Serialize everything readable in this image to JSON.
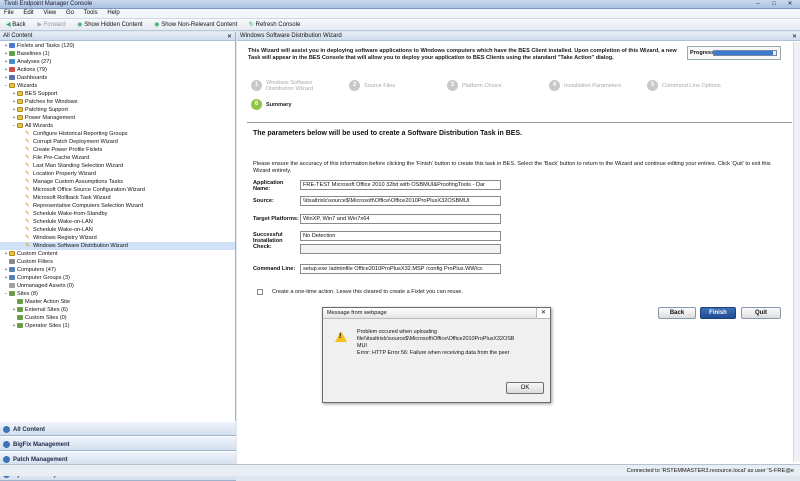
{
  "window": {
    "title": "Tivoli Endpoint Manager Console",
    "min": "–",
    "max": "□",
    "close": "✕"
  },
  "menu": [
    "File",
    "Edit",
    "View",
    "Go",
    "Tools",
    "Help"
  ],
  "toolbar": {
    "back": "Back",
    "forward": "Forward",
    "show_hidden": "Show Hidden Content",
    "show_nonrelevant": "Show Non-Relevant Content",
    "refresh": "Refresh Console"
  },
  "left_header": {
    "title": "All Content",
    "close": "✕"
  },
  "tree": [
    {
      "label": "Fixlets and Tasks (120)",
      "level": 0,
      "icon": "fixlet-icon",
      "exp": "+"
    },
    {
      "label": "Baselines (1)",
      "level": 0,
      "icon": "baseline-icon",
      "exp": "+"
    },
    {
      "label": "Analyses (27)",
      "level": 0,
      "icon": "analysis-icon",
      "exp": "+"
    },
    {
      "label": "Actions (79)",
      "level": 0,
      "icon": "action-icon",
      "exp": "+"
    },
    {
      "label": "Dashboards",
      "level": 0,
      "icon": "dashboard-icon",
      "exp": "+"
    },
    {
      "label": "Wizards",
      "level": 0,
      "icon": "folder-icon",
      "exp": "−"
    },
    {
      "label": "BES Support",
      "level": 1,
      "icon": "folder-icon",
      "exp": "+"
    },
    {
      "label": "Patches for Windows",
      "level": 1,
      "icon": "folder-icon",
      "exp": "+"
    },
    {
      "label": "Patching Support",
      "level": 1,
      "icon": "folder-icon",
      "exp": "+"
    },
    {
      "label": "Power Management",
      "level": 1,
      "icon": "folder-icon",
      "exp": "+"
    },
    {
      "label": "All Wizards",
      "level": 1,
      "icon": "folder-icon",
      "exp": "−"
    },
    {
      "label": "Configure Historical Reporting Groups",
      "level": 2,
      "icon": "wizard-icon",
      "exp": ""
    },
    {
      "label": "Corrupt Patch Deployment Wizard",
      "level": 2,
      "icon": "wizard-icon",
      "exp": ""
    },
    {
      "label": "Create Power Profile Fixlets",
      "level": 2,
      "icon": "wizard-icon",
      "exp": ""
    },
    {
      "label": "File Pre-Cache Wizard",
      "level": 2,
      "icon": "wizard-icon",
      "exp": ""
    },
    {
      "label": "Last Man Standing Selection Wizard",
      "level": 2,
      "icon": "wizard-icon",
      "exp": ""
    },
    {
      "label": "Location Property Wizard",
      "level": 2,
      "icon": "wizard-icon",
      "exp": ""
    },
    {
      "label": "Manage Custom Assumptions Tasks",
      "level": 2,
      "icon": "wizard-icon",
      "exp": ""
    },
    {
      "label": "Microsoft Office Source Configuration Wizard",
      "level": 2,
      "icon": "wizard-icon",
      "exp": ""
    },
    {
      "label": "Microsoft Rollback Task Wizard",
      "level": 2,
      "icon": "wizard-icon",
      "exp": ""
    },
    {
      "label": "Representative Computers Selection Wizard",
      "level": 2,
      "icon": "wizard-icon",
      "exp": ""
    },
    {
      "label": "Schedule Wake-from-Standby",
      "level": 2,
      "icon": "wizard-icon",
      "exp": ""
    },
    {
      "label": "Schedule Wake-on-LAN",
      "level": 2,
      "icon": "wizard-icon",
      "exp": ""
    },
    {
      "label": "Schedule Wake-on-LAN",
      "level": 2,
      "icon": "wizard-icon",
      "exp": ""
    },
    {
      "label": "Windows Registry Wizard",
      "level": 2,
      "icon": "wizard-icon",
      "exp": ""
    },
    {
      "label": "Windows Software Distribution Wizard",
      "level": 2,
      "icon": "wizard-icon",
      "exp": "",
      "selected": true
    },
    {
      "label": "Custom Content",
      "level": 0,
      "icon": "folder-icon",
      "exp": "+"
    },
    {
      "label": "Custom Filters",
      "level": 0,
      "icon": "filter-icon",
      "exp": ""
    },
    {
      "label": "Computers (47)",
      "level": 0,
      "icon": "computer-icon",
      "exp": "+"
    },
    {
      "label": "Computer Groups (3)",
      "level": 0,
      "icon": "computer-group-icon",
      "exp": "+"
    },
    {
      "label": "Unmanaged Assets (0)",
      "level": 0,
      "icon": "asset-icon",
      "exp": ""
    },
    {
      "label": "Sites (8)",
      "level": 0,
      "icon": "site-icon",
      "exp": "−"
    },
    {
      "label": "Master Action Site",
      "level": 1,
      "icon": "site-icon",
      "exp": ""
    },
    {
      "label": "External Sites (6)",
      "level": 1,
      "icon": "site-icon",
      "exp": "+"
    },
    {
      "label": "Custom Sites (0)",
      "level": 1,
      "icon": "site-icon",
      "exp": ""
    },
    {
      "label": "Operator Sites (1)",
      "level": 1,
      "icon": "site-icon",
      "exp": "+"
    }
  ],
  "nav": [
    "All Content",
    "BigFix Management",
    "Patch Management",
    "Systems Lifecycle"
  ],
  "right_header": {
    "title": "Windows Software Distribution Wizard",
    "close": "✕"
  },
  "intro": "This Wizard will assist you in deploying software applications to Windows computers which have the BES Client installed. Upon completion of this Wizard, a new Task will appear in the BES Console that will allow you to deploy your application to BES Clients using the standard \"Take Action\" dialog.",
  "progress": {
    "label": "Progress:",
    "fraction": 0.95
  },
  "steps": [
    {
      "num": "1",
      "label": "Windows Software Distribution Wizard"
    },
    {
      "num": "2",
      "label": "Source Files"
    },
    {
      "num": "3",
      "label": "Platform Choice"
    },
    {
      "num": "4",
      "label": "Installation Parameters"
    },
    {
      "num": "5",
      "label": "Command Line Options"
    },
    {
      "num": "6",
      "label": "Summary",
      "active": true
    }
  ],
  "form": {
    "heading": "The parameters below will be used to create a Software Distribution Task in BES.",
    "note": "Please ensure the accuracy of this information before clicking the 'Finish' button to create this task in BES. Select the 'Back' button to return to the Wizard and continue editing your entries. Click 'Quit' to exit this Wizard entirely.",
    "fields": [
      {
        "label": "Application Name:",
        "value": "FRE-TEST Microsoft Office 2010 32bit with OSBMUI&ProofingTools - Dar"
      },
      {
        "label": "Source:",
        "value": "\\\\itsaltrislc\\source$\\Microsoft\\Office\\Office2010ProPlusX32OSBMUI"
      },
      {
        "label": "Target Platforms:",
        "value": "WinXP, Win7 and Win7x64"
      },
      {
        "label": "Successful Installation Check:",
        "value": "No Detection"
      },
      {
        "label": "",
        "value": ""
      },
      {
        "label": "Command Line:",
        "value": "setup.exe /adminfile Office2010ProPlusX32.MSP /config ProPlus.WW\\cc"
      }
    ],
    "checkbox_label": "Create a one-time action. Leave this cleared to create a Fixlet you can reuse."
  },
  "buttons": {
    "back": "Back",
    "finish": "Finish",
    "quit": "Quit"
  },
  "dialog": {
    "title": "Message from webpage",
    "close": "✕",
    "lines": [
      "Problem occured when uploading",
      "file\\\\itsaltrislc\\source$\\Microsoft\\Office\\Office2010ProPlusX32OSB",
      "MUI",
      "Error: HTTP Error 56: Failure when receiving data from the peer"
    ],
    "ok": "OK"
  },
  "status": "Connected to 'RSTEMMASTER3.resource.local' as user 'S-FRE@e"
}
